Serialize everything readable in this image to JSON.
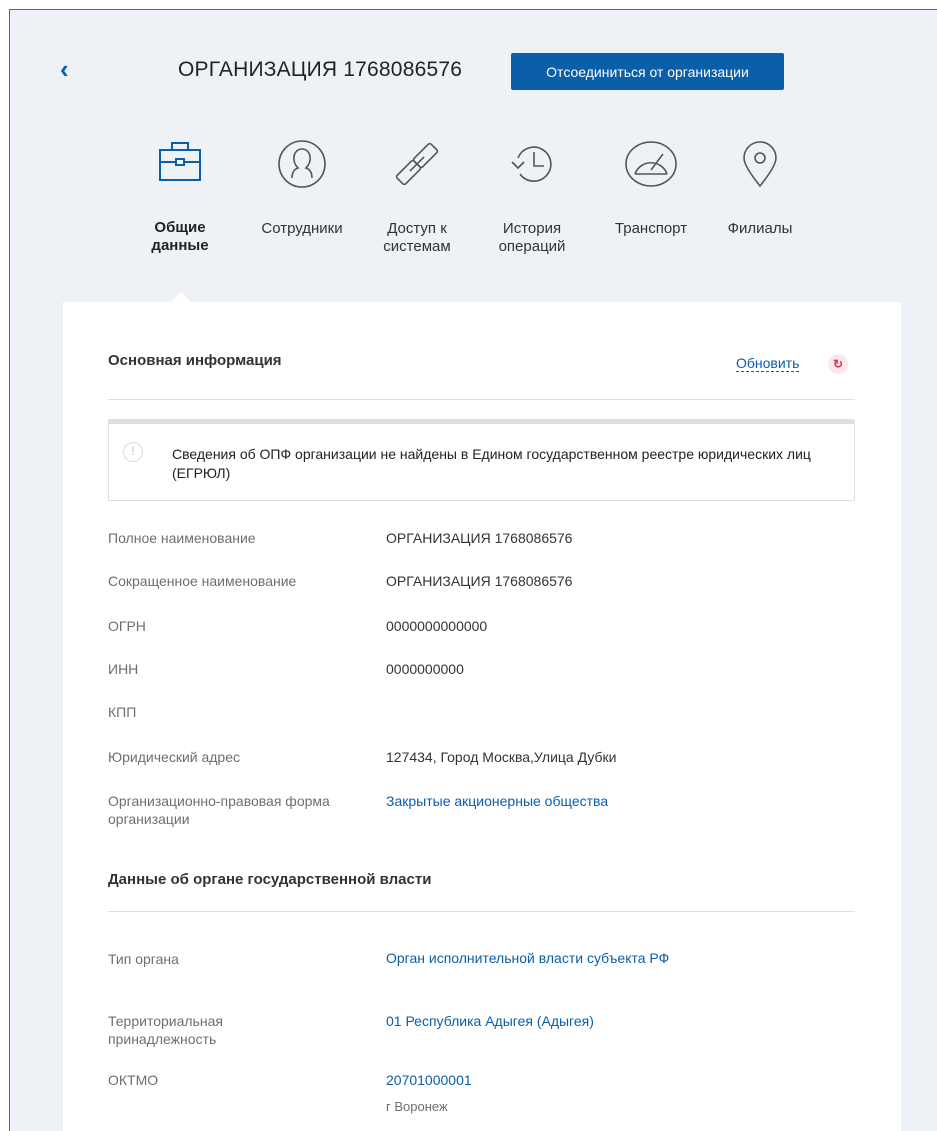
{
  "header": {
    "title": "ОРГАНИЗАЦИЯ 1768086576",
    "disconnect_label": "Отсоединиться от организации"
  },
  "tabs": [
    {
      "label": "Общие данные",
      "icon": "briefcase-icon",
      "active": true
    },
    {
      "label": "Сотрудники",
      "icon": "person-icon",
      "active": false
    },
    {
      "label": "Доступ к системам",
      "icon": "link-icon",
      "active": false
    },
    {
      "label": "История операций",
      "icon": "history-icon",
      "active": false
    },
    {
      "label": "Транспорт",
      "icon": "speedometer-icon",
      "active": false
    },
    {
      "label": "Филиалы",
      "icon": "location-pin-icon",
      "active": false
    }
  ],
  "main_info": {
    "title": "Основная информация",
    "refresh_label": "Обновить",
    "alert_text": "Сведения об ОПФ организации не найдены в Едином государственном реестре юридических лиц (ЕГРЮЛ)",
    "rows": [
      {
        "label": "Полное наименование",
        "value": "ОРГАНИЗАЦИЯ 1768086576",
        "link": false
      },
      {
        "label": "Сокращенное наименование",
        "value": "ОРГАНИЗАЦИЯ 1768086576",
        "link": false
      },
      {
        "label": "ОГРН",
        "value": "0000000000000",
        "link": false
      },
      {
        "label": "ИНН",
        "value": "0000000000",
        "link": false
      },
      {
        "label": "КПП",
        "value": "",
        "link": false
      },
      {
        "label": "Юридический адрес",
        "value": "127434, Город Москва,Улица Дубки",
        "link": false
      },
      {
        "label": "Организационно-правовая форма организации",
        "value": "Закрытые акционерные общества",
        "link": true
      }
    ]
  },
  "gov_info": {
    "title": "Данные об органе государственной власти",
    "rows": [
      {
        "label": "Тип органа",
        "value": "Орган исполнительной власти субъекта РФ",
        "link": true
      },
      {
        "label": "Территориальная принадлежность",
        "value": "01 Республика Адыгея (Адыгея)",
        "link": true
      },
      {
        "label": "ОКТМО",
        "value": "20701000001",
        "sub": "г Воронеж",
        "link": true
      }
    ]
  },
  "colors": {
    "accent": "#0b5ea8",
    "background": "#eef1f5",
    "label_gray": "#6b6f75"
  }
}
